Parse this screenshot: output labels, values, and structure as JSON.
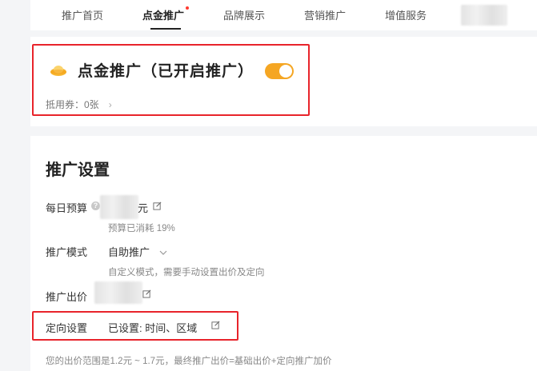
{
  "nav": {
    "tabs": [
      {
        "label": "推广首页"
      },
      {
        "label": "点金推广"
      },
      {
        "label": "品牌展示"
      },
      {
        "label": "营销推广"
      },
      {
        "label": "增值服务"
      }
    ]
  },
  "hero": {
    "title": "点金推广（已开启推广）",
    "toggle_on": true,
    "voucher": "抵用券：0张",
    "voucher_chevron": "›"
  },
  "settings": {
    "title": "推广设置",
    "daily_budget_label": "每日预算",
    "daily_budget_unit": "元",
    "daily_budget_hint": "预算已消耗 19%",
    "mode_label": "推广模式",
    "mode_value": "自助推广",
    "mode_hint": "自定义模式，需要手动设置出价及定向",
    "bid_label": "推广出价",
    "targeting_label": "定向设置",
    "targeting_value": "已设置: 时间、区域",
    "price_note": "您的出价范围是1.2元 ~ 1.7元，最终推广出价=基础出价+定向推广加价"
  },
  "colors": {
    "accent": "#f5a623",
    "highlight_border": "#e8242b"
  }
}
